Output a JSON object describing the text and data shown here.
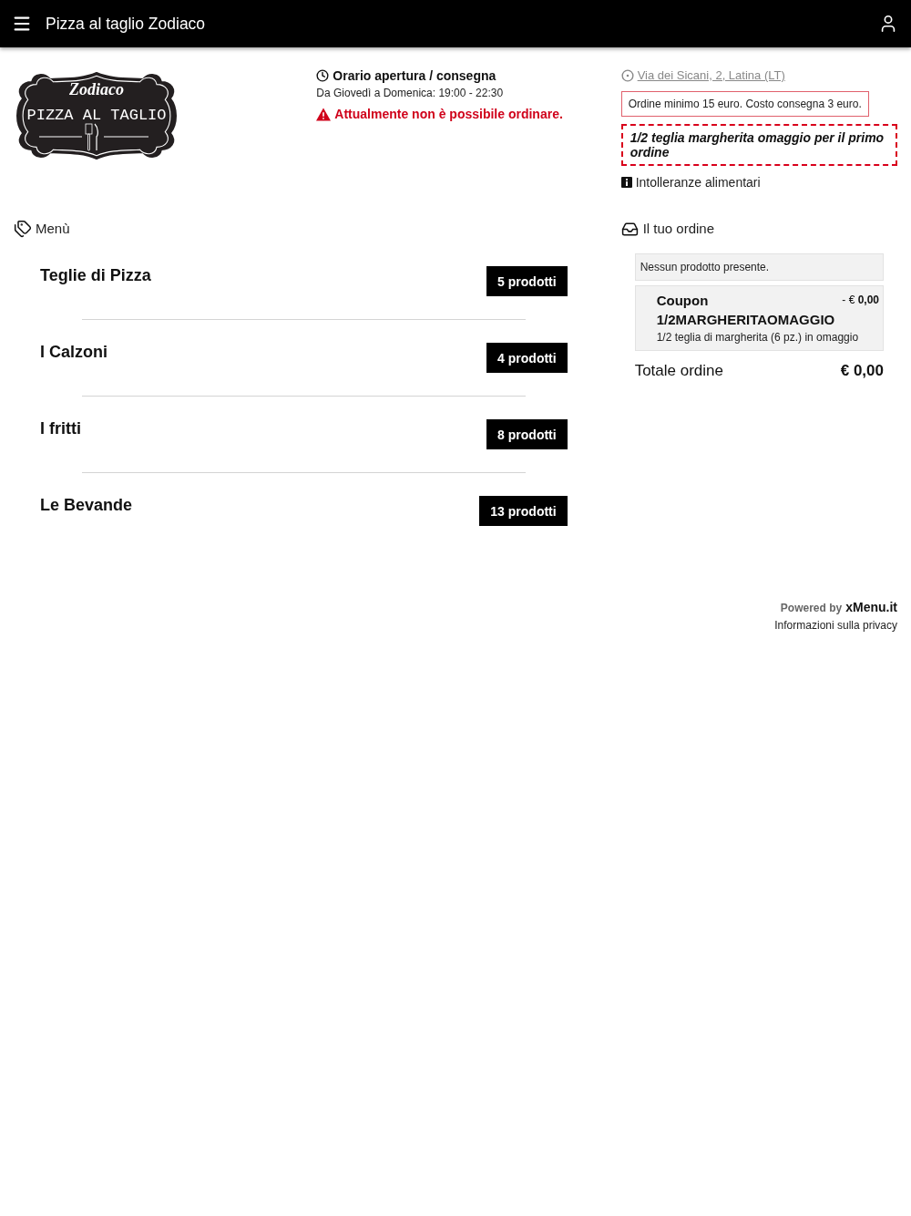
{
  "header": {
    "title": "Pizza al taglio Zodiaco"
  },
  "logo": {
    "script": "Zodiaco",
    "tagline": "PIZZA AL TAGLIO"
  },
  "hours": {
    "title": "Orario apertura / consegna",
    "schedule": "Da Giovedì a Domenica: 19:00 - 22:30",
    "warning": "Attualmente non è possibile ordinare."
  },
  "info": {
    "address": "Via dei Sicani, 2, Latina (LT)",
    "notice": "Ordine minimo 15 euro. Costo consegna 3 euro.",
    "promo": "1/2 teglia margherita omaggio per il primo ordine",
    "allergens": "Intolleranze alimentari"
  },
  "menu": {
    "title": "Menù",
    "categories": [
      {
        "name": "Teglie di Pizza",
        "count": "5 prodotti"
      },
      {
        "name": "I Calzoni",
        "count": "4 prodotti"
      },
      {
        "name": "I fritti",
        "count": "8 prodotti"
      },
      {
        "name": "Le Bevande",
        "count": "13 prodotti"
      }
    ]
  },
  "order": {
    "title": "Il tuo ordine",
    "empty_message": "Nessun prodotto presente.",
    "coupon": {
      "label": "Coupon",
      "discount": "- € **0,00**",
      "code": "1/2MARGHERITAOMAGGIO",
      "description": "1/2 teglia di margherita (6 pz.) in omaggio"
    },
    "total_label": "Totale ordine",
    "total": "€ 0,00"
  },
  "footer": {
    "powered_by": "Powered by",
    "brand": "xMenu.it",
    "privacy": "Informazioni sulla privacy"
  }
}
